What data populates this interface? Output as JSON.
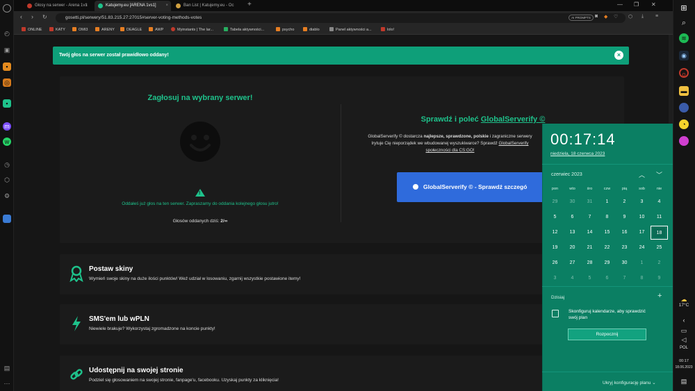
{
  "browser": {
    "tabs": [
      {
        "label": "Głosy na serwer - Arena 1v1",
        "active": false
      },
      {
        "label": "Katujemy.eu [ARENA 1vs1]",
        "active": true
      },
      {
        "label": "Ban List | Katujemy.eu - Oc",
        "active": false
      }
    ],
    "new_tab": "+",
    "url": "gosetti.pl/serwery/51.83.215.27:27015#server-voting-methods-votes",
    "ai_prompts": "AI PROMPTS",
    "bookmarks": [
      {
        "label": "ONLINE",
        "color": "#c0392b"
      },
      {
        "label": "KATY",
        "color": "#c0392b"
      },
      {
        "label": "OMI3",
        "color": "#e67e22"
      },
      {
        "label": "ARENY",
        "color": "#e67e22"
      },
      {
        "label": "DEAGLE",
        "color": "#e67e22"
      },
      {
        "label": "AWP",
        "color": "#e67e22"
      },
      {
        "label": "Myinstants | The lar...",
        "color": "#c0392b"
      },
      {
        "label": "Tabela aktywności...",
        "color": "#27ae60"
      },
      {
        "label": "psycho",
        "color": "#e67e22"
      },
      {
        "label": "diablo",
        "color": "#e67e22"
      },
      {
        "label": "Panel aktywności a...",
        "color": "#888888"
      },
      {
        "label": "lolo!",
        "color": "#c0392b"
      }
    ]
  },
  "alert": {
    "message": "Twój głos na serwer został prawidłowo oddany!",
    "close": "×"
  },
  "vote": {
    "title": "Zagłosuj na wybrany serwer!",
    "note": "Oddałeś już głos na ten serwer. Zapraszamy do oddania kolejnego głosu jutro!",
    "count_label": "Głosów oddanych dziś:",
    "count_value": "2/∞"
  },
  "globalserverify": {
    "title_prefix": "Sprawdź i poleć",
    "title_link": "GlobalServerify ©",
    "desc_line1_a": "GlobalServerify © dostarcza",
    "desc_bold1": "najlepsze, sprawdzone, polskie",
    "desc_line1_b": "i zagraniczne serwery",
    "desc_line2": "Irytuje Cię nieporządek we wbudowanej wyszukiwarce? Sprawdź",
    "desc_link": "GlobalServerify",
    "desc_line3": "społeczności dla CS:GO!",
    "button": "GlobalServerify © - Sprawdź szczegó"
  },
  "features": [
    {
      "title": "Postaw skiny",
      "desc": "Wymień swoje skiny na duże ilości punktów! Weź udział w losowaniu, zgarnij wszystkie postawione itemy!",
      "icon": "award-icon"
    },
    {
      "title": "SMS'em lub wPLN",
      "desc": "Niewiele brakuje? Wykorzystaj zgromadzone na koncie punkty!",
      "icon": "bolt-icon"
    },
    {
      "title": "Udostępnij na swojej stronie",
      "desc": "Podziel się głosowaniem na swojej stronie, fanpage'u, facebooku. Uzyskaj punkty za kliknięcia!",
      "icon": "link-icon"
    }
  ],
  "calendar": {
    "time": "00:17:14",
    "date": "niedziela, 18 czerwca 2023",
    "month": "czerwiec 2023",
    "weekdays": [
      "pon",
      "wto",
      "śro",
      "czw",
      "pią",
      "sob",
      "nie"
    ],
    "days": [
      [
        "29",
        "30",
        "31",
        "1",
        "2",
        "3",
        "4"
      ],
      [
        "5",
        "6",
        "7",
        "8",
        "9",
        "10",
        "11"
      ],
      [
        "12",
        "13",
        "14",
        "15",
        "16",
        "17",
        "18"
      ],
      [
        "19",
        "20",
        "21",
        "22",
        "23",
        "24",
        "25"
      ],
      [
        "26",
        "27",
        "28",
        "29",
        "30",
        "1",
        "2"
      ],
      [
        "3",
        "4",
        "5",
        "6",
        "7",
        "8",
        "9"
      ]
    ],
    "today_label": "Dzisiaj",
    "event_text": "Skonfiguruj kalendarze, aby sprawdzić swój plan",
    "start_button": "Rozpocznij",
    "hide_link": "Ukryj konfigurację planu"
  },
  "taskbar": {
    "weather_temp": "17°C",
    "language": "POL",
    "clock_time": "00:17",
    "clock_date": "18.06.2023"
  }
}
